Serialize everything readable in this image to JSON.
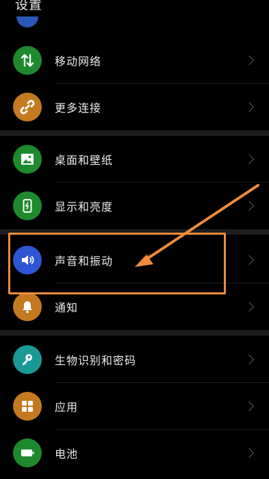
{
  "header": {
    "title": "设置"
  },
  "settings": {
    "items": [
      {
        "label": "移动网络",
        "icon": "data-arrows-icon",
        "color": "#1e8a2e"
      },
      {
        "label": "更多连接",
        "icon": "link-icon",
        "color": "#c47a1e"
      },
      {
        "label": "桌面和壁纸",
        "icon": "image-icon",
        "color": "#1e8a2e"
      },
      {
        "label": "显示和亮度",
        "icon": "phone-brightness-icon",
        "color": "#1e8a2e"
      },
      {
        "label": "声音和振动",
        "icon": "speaker-icon",
        "color": "#2f55d4"
      },
      {
        "label": "通知",
        "icon": "bell-icon",
        "color": "#c47a1e"
      },
      {
        "label": "生物识别和密码",
        "icon": "key-icon",
        "color": "#1a9a96"
      },
      {
        "label": "应用",
        "icon": "grid-icon",
        "color": "#c47a1e"
      },
      {
        "label": "电池",
        "icon": "battery-icon",
        "color": "#1e8a2e"
      }
    ]
  },
  "annotation": {
    "color": "#f28c3a"
  }
}
